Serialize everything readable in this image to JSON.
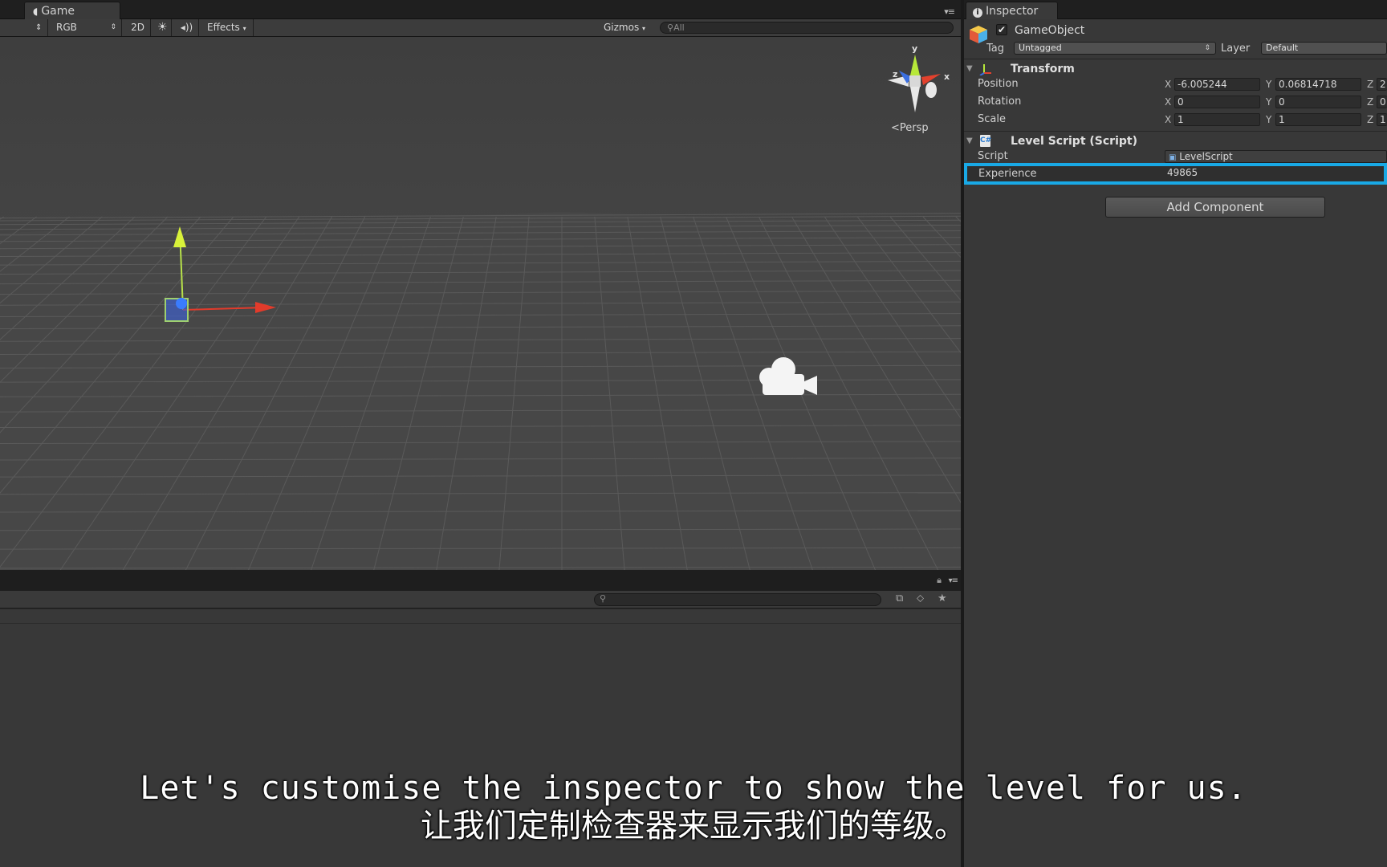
{
  "scene_window": {
    "tab_label": "Game",
    "toolbar": {
      "shading_mode": "RGB",
      "mode_2d": "2D",
      "effects_label": "Effects",
      "gizmos_label": "Gizmos",
      "search_placeholder": "All"
    },
    "orientation_gizmo": {
      "y_label": "y",
      "x_label": "x",
      "z_label": "z",
      "projection_label": "Persp"
    }
  },
  "inspector": {
    "tab_label": "Inspector",
    "game_object": {
      "name": "GameObject",
      "active": true,
      "tag_label": "Tag",
      "tag_value": "Untagged",
      "layer_label": "Layer",
      "layer_value": "Default"
    },
    "transform": {
      "title": "Transform",
      "rows": [
        {
          "label": "Position",
          "x": "-6.005244",
          "y": "0.06814718",
          "z": "2"
        },
        {
          "label": "Rotation",
          "x": "0",
          "y": "0",
          "z": "0"
        },
        {
          "label": "Scale",
          "x": "1",
          "y": "1",
          "z": "1"
        }
      ],
      "axis_x": "X",
      "axis_y": "Y",
      "axis_z": "Z"
    },
    "level_script": {
      "title": "Level Script (Script)",
      "script_label": "Script",
      "script_value": "LevelScript",
      "experience_label": "Experience",
      "experience_value": "49865"
    },
    "add_component_label": "Add Component",
    "highlight_color": "#19a9e6"
  },
  "subtitles": {
    "english": "Let's customise the inspector to show the level for us.",
    "chinese": "让我们定制检查器来显示我们的等级。"
  }
}
